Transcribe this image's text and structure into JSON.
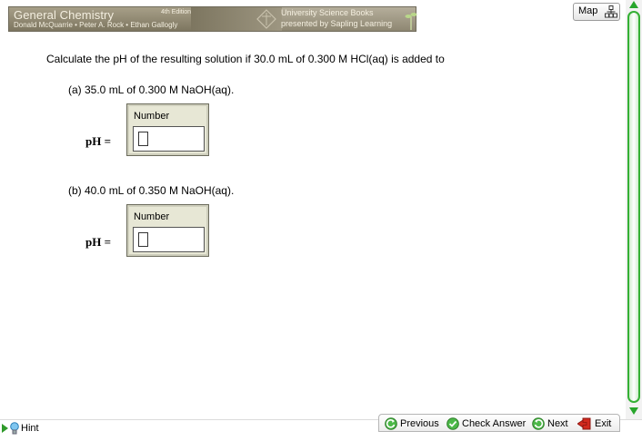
{
  "header": {
    "book_title": "General Chemistry",
    "edition": "4th Edition",
    "authors": "Donald McQuarrie • Peter A. Rock • Ethan Gallogly",
    "publisher_line1": "University Science Books",
    "publisher_line2": "presented by Sapling Learning"
  },
  "map_button": {
    "label": "Map"
  },
  "question": {
    "prompt": "Calculate the pH of the resulting solution if 30.0 mL of 0.300 M HCl(aq) is added to",
    "parts": [
      {
        "label": "(a) 35.0 mL of 0.300 M NaOH(aq).",
        "answer_label": "pH =",
        "box_header": "Number",
        "value": ""
      },
      {
        "label": "(b) 40.0 mL of 0.350 M NaOH(aq).",
        "answer_label": "pH =",
        "box_header": "Number",
        "value": ""
      }
    ]
  },
  "footer": {
    "hint": "Hint",
    "previous": "Previous",
    "check_answer": "Check Answer",
    "next": "Next",
    "exit": "Exit"
  },
  "colors": {
    "accent_green": "#2f9a2a",
    "banner": "#8e8772",
    "exit_red": "#d22a1f"
  }
}
